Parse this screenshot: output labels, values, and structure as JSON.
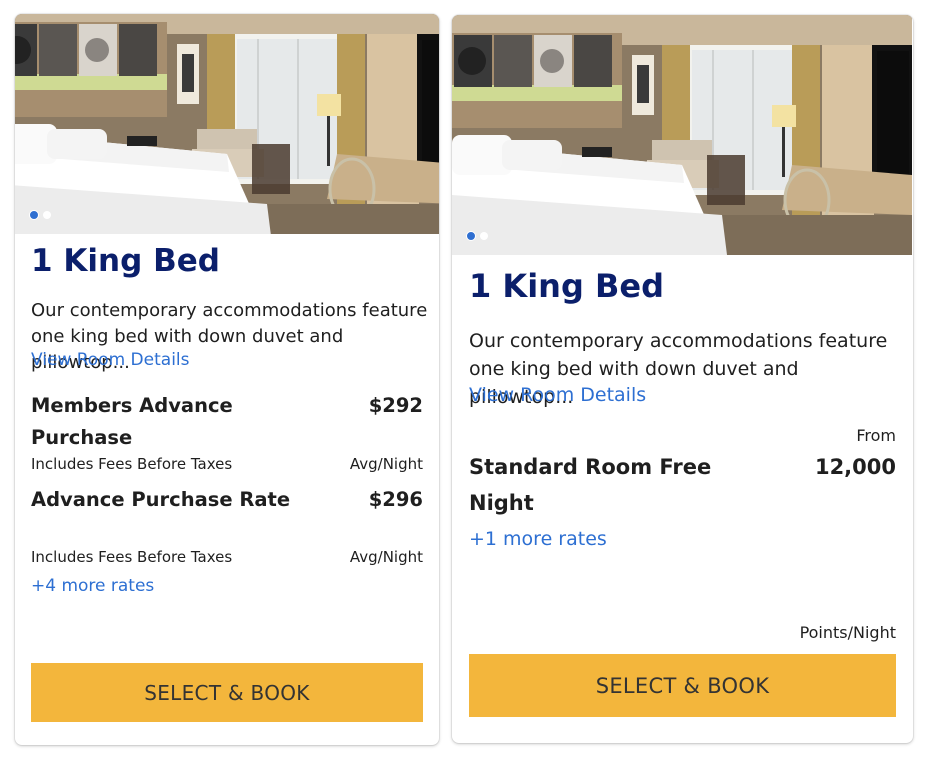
{
  "rooms": [
    {
      "title": "1 King Bed",
      "description": "Our contemporary accommodations feature one king bed with down duvet and pillowtop...",
      "details_link": "View Room Details",
      "rates": [
        {
          "name": "Members Advance Purchase",
          "price": "$292",
          "note": "Includes Fees Before Taxes",
          "unit": "Avg/Night"
        },
        {
          "name": "Advance Purchase Rate",
          "price": "$296",
          "note": "Includes Fees Before Taxes",
          "unit": "Avg/Night"
        }
      ],
      "more_rates": "+4 more rates",
      "book_button": "SELECT & BOOK",
      "carousel": {
        "count": 2,
        "active": 1
      }
    },
    {
      "title": "1 King Bed",
      "description": "Our contemporary accommodations feature one king bed with down duvet and pillowtop...",
      "details_link": "View Room Details",
      "price_prefix": "From",
      "rates": [
        {
          "name": "Standard Room Free Night",
          "price": "12,000"
        }
      ],
      "more_rates": "+1 more rates",
      "price_unit": "Points/Night",
      "book_button": "SELECT & BOOK",
      "carousel": {
        "count": 2,
        "active": 1
      }
    }
  ],
  "colors": {
    "title": "#0b1f6b",
    "link": "#2d6fd2",
    "button": "#f3b63c",
    "carousel_active": "#2f6fd1"
  }
}
